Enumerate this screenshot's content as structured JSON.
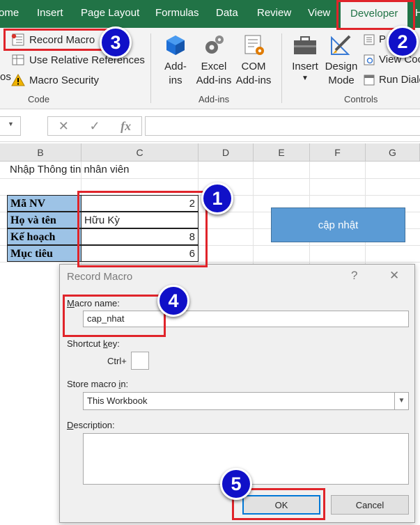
{
  "ribbon_tabs": [
    "ome",
    "Insert",
    "Page Layout",
    "Formulas",
    "Data",
    "Review",
    "View",
    "Developer",
    "H"
  ],
  "code_group": {
    "record_macro": "Record Macro",
    "relative_refs": "Use Relative References",
    "macro_security": "Macro Security",
    "left_cut": "os",
    "label": "Code"
  },
  "addins_group": {
    "addins_line1": "Add-",
    "addins_line2": "ins",
    "excel_line1": "Excel",
    "excel_line2": "Add-ins",
    "com_line1": "COM",
    "com_line2": "Add-ins",
    "label": "Add-ins"
  },
  "controls_group": {
    "insert": "Insert",
    "design_line1": "Design",
    "design_line2": "Mode",
    "properties": "P",
    "view_code": "View Coc",
    "run_dialog": "Run Dialo",
    "label": "Controls"
  },
  "formula_bar": {
    "fx": "fx",
    "cancel": "✕",
    "enter": "✓"
  },
  "columns": [
    "B",
    "C",
    "D",
    "E",
    "F",
    "G"
  ],
  "sheet": {
    "title": "Nhập Thông tin nhân viên",
    "rows": [
      {
        "label": "Mã NV",
        "value": "2"
      },
      {
        "label": "Họ và tên",
        "value": "Hữu Kỳ"
      },
      {
        "label": "Kế hoạch",
        "value": "8"
      },
      {
        "label": "Mục tiêu",
        "value": "6"
      }
    ],
    "update_button": "cập nhật"
  },
  "dialog": {
    "title": "Record Macro",
    "help": "?",
    "close": "✕",
    "macro_name_label_first": "M",
    "macro_name_label_rest": "acro name:",
    "macro_name_value": "cap_nhat",
    "shortcut_label_start": "Shortcut ",
    "shortcut_label_key": "k",
    "shortcut_label_end": "ey:",
    "ctrl": "Ctrl+",
    "shortcut_value": "",
    "store_label_start": "Store macro ",
    "store_label_key": "i",
    "store_label_end": "n:",
    "store_value": "This Workbook",
    "description_label_first": "D",
    "description_label_rest": "escription:",
    "description_value": "",
    "ok": "OK",
    "cancel": "Cancel"
  },
  "badges": [
    "1",
    "2",
    "3",
    "4",
    "5"
  ],
  "colors": {
    "ribbon_green": "#217346",
    "label_blue": "#9dc3e6",
    "button_blue": "#5b9bd5",
    "annotation_red": "#e0242a",
    "badge_blue": "#1010c8"
  }
}
